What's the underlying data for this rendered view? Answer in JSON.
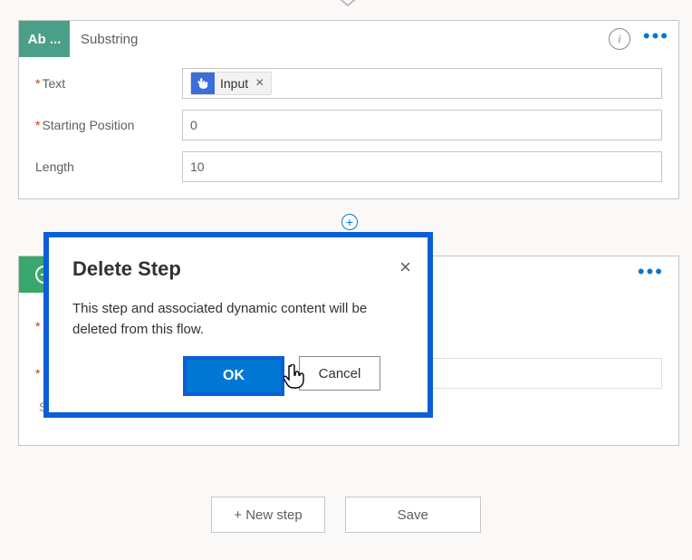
{
  "substring_card": {
    "badge_text": "Ab ...",
    "title": "Substring",
    "text_label": "Text",
    "token_label": "Input",
    "starting_position_label": "Starting Position",
    "starting_position_value": "0",
    "length_label": "Length",
    "length_value": "10"
  },
  "second_card": {
    "star1": "*",
    "star2": "*",
    "s_text": "S"
  },
  "dialog": {
    "title": "Delete Step",
    "message": "This step and associated dynamic content will be deleted from this flow.",
    "ok_label": "OK",
    "cancel_label": "Cancel"
  },
  "bottom": {
    "new_step_label": "+ New step",
    "save_label": "Save"
  }
}
